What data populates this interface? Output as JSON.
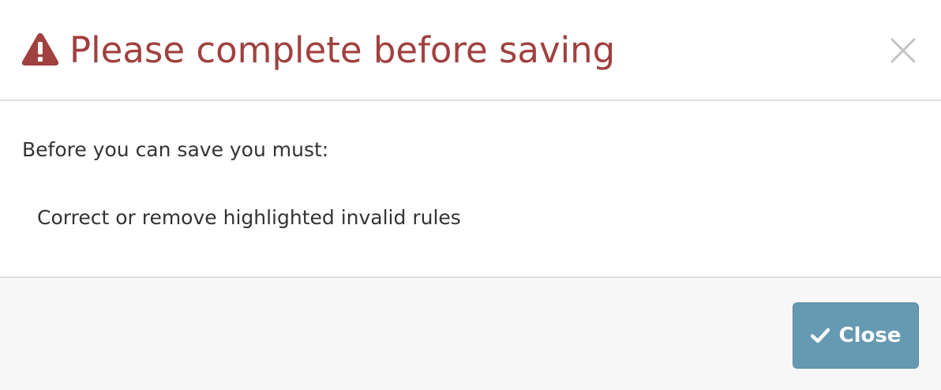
{
  "dialog": {
    "title": "Please complete before saving",
    "title_icon": "warning-triangle-icon",
    "dismiss_icon": "close-icon",
    "colors": {
      "title": "#a0413f",
      "button": "#6699b2",
      "footer_bg": "#f7f7f7"
    }
  },
  "body": {
    "intro": "Before you can save you must:",
    "requirements": [
      "Correct or remove highlighted invalid rules"
    ]
  },
  "footer": {
    "close_label": "Close",
    "close_icon": "check-icon"
  }
}
